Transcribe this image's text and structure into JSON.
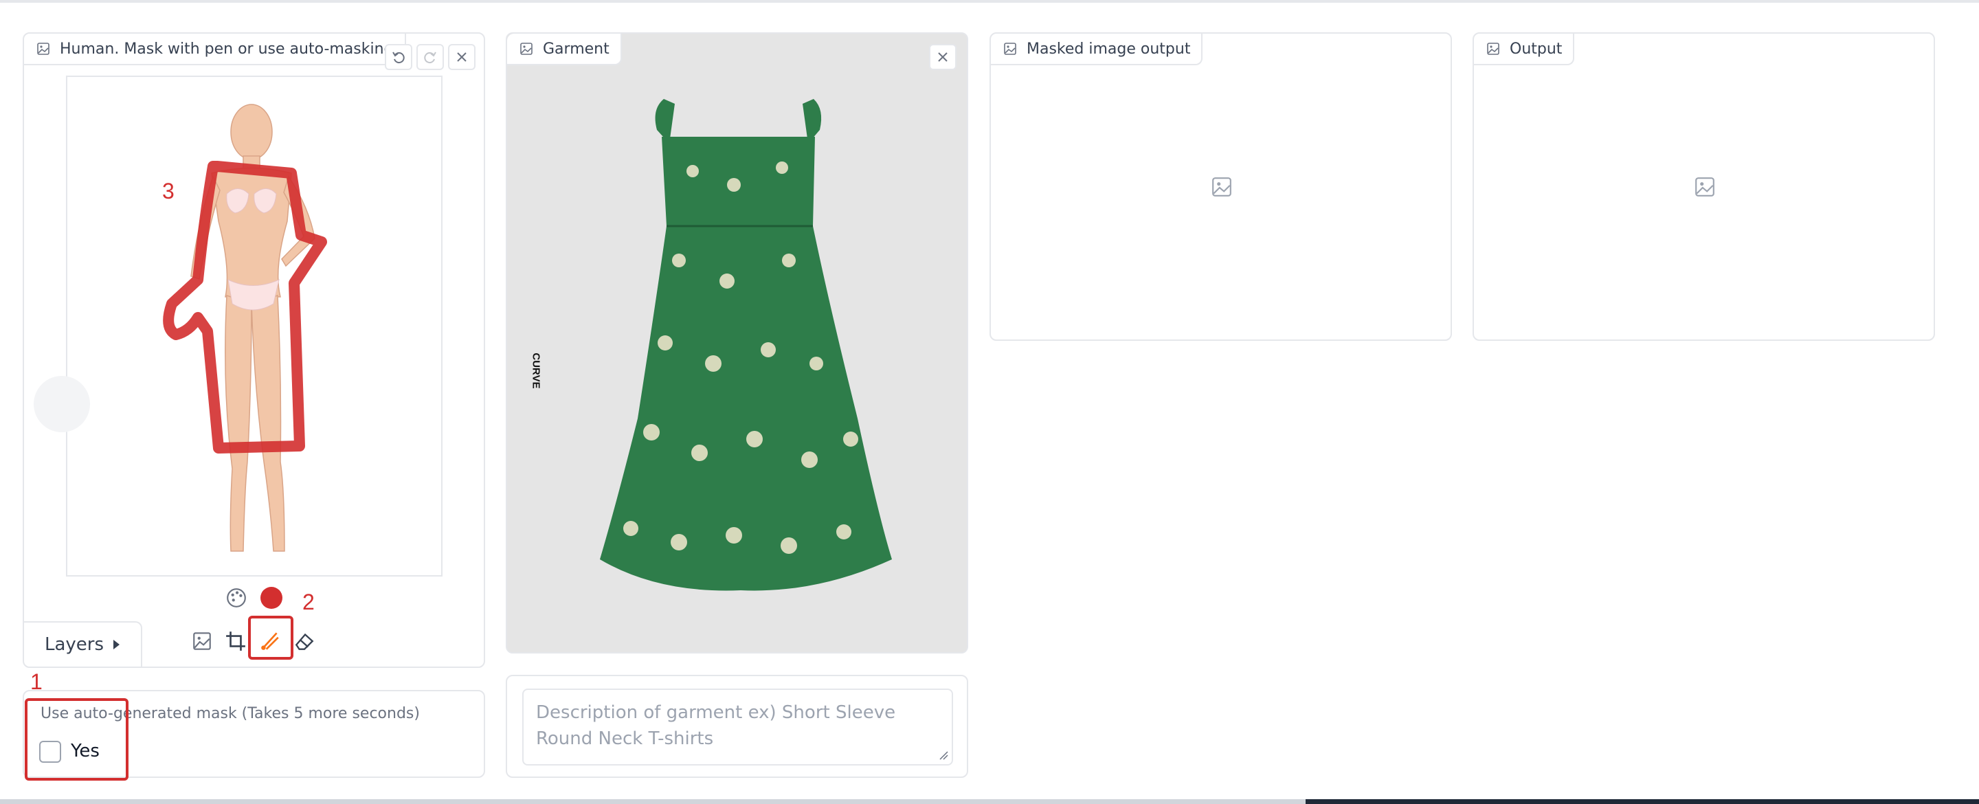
{
  "human_panel": {
    "label": "Human. Mask with pen or use auto-masking",
    "layers_label": "Layers",
    "brush_color": "#d32f2f"
  },
  "garment_panel": {
    "label": "Garment",
    "brand_text": "CURVE"
  },
  "masked_panel": {
    "label": "Masked image output"
  },
  "output_panel": {
    "label": "Output"
  },
  "auto_mask": {
    "label": "Use auto-generated mask (Takes 5 more seconds)",
    "checkbox_label": "Yes"
  },
  "description": {
    "placeholder": "Description of garment ex) Short Sleeve Round Neck T-shirts"
  },
  "annotations": {
    "a1": "1",
    "a2": "2",
    "a3": "3"
  },
  "colors": {
    "annotation_red": "#d32f2f",
    "border": "#e5e7eb",
    "garment_bg": "#e5e5e5",
    "dress_green": "#2e7d4a"
  }
}
